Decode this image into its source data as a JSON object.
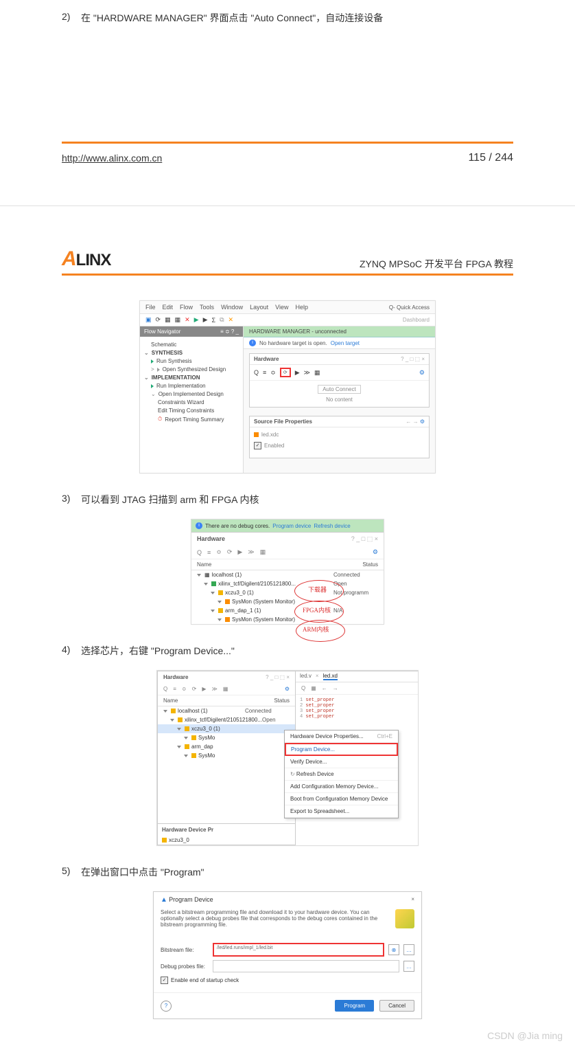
{
  "page1": {
    "step2_num": "2)",
    "step2_txt": "在 \"HARDWARE MANAGER\" 界面点击 \"Auto Connect\"，自动连接设备",
    "footer_url": "http://www.alinx.com.cn",
    "page_no": "115 / 244"
  },
  "page2": {
    "logo_first": "A",
    "logo_rest": "LINX",
    "subtitle": "ZYNQ MPSoC 开发平台 FPGA 教程",
    "shot1": {
      "menus": [
        "File",
        "Edit",
        "Flow",
        "Tools",
        "Window",
        "Layout",
        "View",
        "Help"
      ],
      "quick_access": "Q- Quick Access",
      "dashboard": "Dashboard",
      "flow_nav": "Flow Navigator",
      "nav_items": [
        {
          "icon": "",
          "indent": 1,
          "label": "Schematic"
        },
        {
          "section": "SYNTHESIS"
        },
        {
          "icon": "tri",
          "indent": 1,
          "label": "Run Synthesis"
        },
        {
          "icon": "tri gray",
          "indent": 1,
          "label": "Open Synthesized Design",
          "prefix": ">"
        },
        {
          "section": "IMPLEMENTATION"
        },
        {
          "icon": "tri",
          "indent": 1,
          "label": "Run Implementation"
        },
        {
          "icon": "",
          "indent": 1,
          "label": "Open Implemented Design",
          "caret": true
        },
        {
          "icon": "",
          "indent": 2,
          "label": "Constraints Wizard"
        },
        {
          "icon": "",
          "indent": 2,
          "label": "Edit Timing Constraints"
        },
        {
          "icon": "",
          "indent": 2,
          "label": "Report Timing Summary",
          "clock": true
        }
      ],
      "hm_title": "HARDWARE MANAGER - unconnected",
      "info_msg": "No hardware target is open.",
      "open_target": "Open target",
      "hw_panel": "Hardware",
      "hw_ctrl": "?  _  □  ⬚  ×",
      "auto_connect": "Auto Connect",
      "no_content": "No content",
      "sfp_title": "Source File Properties",
      "sfp_file": "led.xdc",
      "enabled": "Enabled"
    },
    "step3_num": "3)",
    "step3_txt": "可以看到 JTAG 扫描到 arm 和 FPGA 内核",
    "shot2": {
      "green_msg": "There are no debug cores.",
      "green_links": [
        "Program device",
        "Refresh device"
      ],
      "title": "Hardware",
      "ctrl": "?  _  □  ⬚  ×",
      "th1": "Name",
      "th2": "Status",
      "rows": [
        {
          "d": 0,
          "icon": "",
          "name": "localhost (1)",
          "status": "Connected"
        },
        {
          "d": 1,
          "icon": "g",
          "name": "xilinx_tcf/Digilent/2105121800...",
          "status": "Open"
        },
        {
          "d": 2,
          "icon": "chip",
          "name": "xczu3_0 (1)",
          "status": "Not programm"
        },
        {
          "d": 3,
          "icon": "o",
          "name": "SysMon (System Monitor)",
          "status": ""
        },
        {
          "d": 2,
          "icon": "chip",
          "name": "arm_dap_1 (1)",
          "status": "N/A"
        },
        {
          "d": 3,
          "icon": "o",
          "name": "SysMon (System Monitor)",
          "status": ""
        }
      ],
      "annotations": [
        "下载器",
        "FPGA内核",
        "ARM内核"
      ]
    },
    "step4_num": "4)",
    "step4_txt": "选择芯片，右键 \"Program Device...\"",
    "shot3": {
      "title": "Hardware",
      "ctrl": "?  _  □  ⬚  ×",
      "th1": "Name",
      "th2": "Status",
      "rows": [
        {
          "d": 0,
          "name": "localhost (1)",
          "status": "Connected"
        },
        {
          "d": 1,
          "name": "xilinx_tcf/Digilent/2105121800...",
          "status": "Open"
        },
        {
          "d": 2,
          "name": "xczu3_0 (1)",
          "status": "",
          "sel": true
        },
        {
          "d": 3,
          "name": "SysMo",
          "status": ""
        },
        {
          "d": 2,
          "name": "arm_dap",
          "status": ""
        },
        {
          "d": 3,
          "name": "SysMo",
          "status": ""
        }
      ],
      "ctx_items": [
        {
          "label": "Hardware Device Properties...",
          "short": "Ctrl+E"
        },
        {
          "label": "Program Device...",
          "hl": true
        },
        {
          "label": "Verify Device..."
        },
        {
          "label": "Refresh Device",
          "icon": "↻"
        },
        {
          "label": "Add Configuration Memory Device..."
        },
        {
          "label": "Boot from Configuration Memory Device"
        },
        {
          "label": "Export to Spreadsheet..."
        }
      ],
      "hdp": "Hardware Device Pr",
      "bottom": "xczu3_0",
      "tabs": [
        "led.v",
        "led.xd"
      ],
      "code_lines": [
        "set_proper",
        "set_proper",
        "set_proper",
        "set_proper"
      ]
    },
    "step5_num": "5)",
    "step5_txt": "在弹出窗口中点击 \"Program\"",
    "shot4": {
      "title": "Program Device",
      "close": "×",
      "desc": "Select a bitstream programming file and download it to your hardware device. You can optionally select a debug probes file that corresponds to the debug cores contained in the bitstream programming file.",
      "bitstream_lbl": "Bitstream file:",
      "bitstream_val": "/led/led.runs/impl_1/led.bit",
      "debug_lbl": "Debug probes file:",
      "debug_val": "",
      "chk": "Enable end of startup check",
      "program_btn": "Program",
      "cancel_btn": "Cancel"
    }
  },
  "watermark": "CSDN @Jia ming"
}
